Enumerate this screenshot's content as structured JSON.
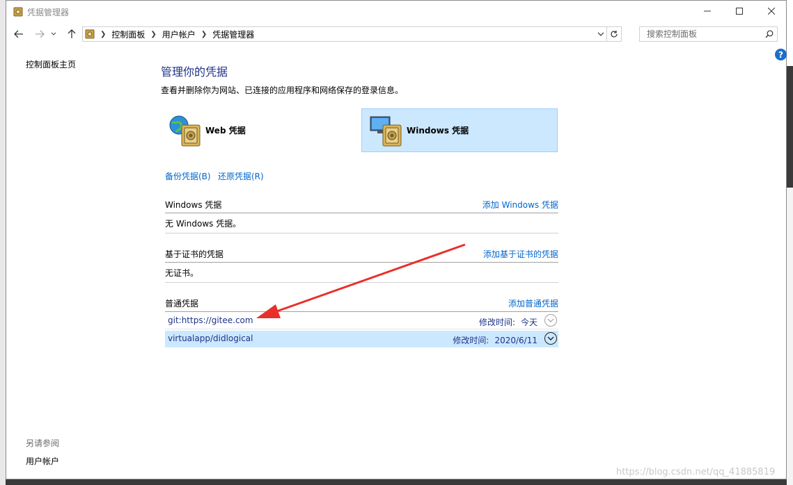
{
  "window": {
    "title": "凭据管理器"
  },
  "breadcrumb": [
    "控制面板",
    "用户帐户",
    "凭据管理器"
  ],
  "search": {
    "placeholder": "搜索控制面板"
  },
  "help": {
    "label": "?"
  },
  "sidebar": {
    "home": "控制面板主页",
    "see_also_heading": "另请参阅",
    "see_also_items": [
      "用户帐户"
    ]
  },
  "main": {
    "title": "管理你的凭据",
    "description": "查看并删除你为网站、已连接的应用程序和网络保存的登录信息。",
    "tiles": [
      {
        "label": "Web 凭据",
        "icon": "web-credential-icon",
        "selected": false
      },
      {
        "label": "Windows 凭据",
        "icon": "windows-credential-icon",
        "selected": true
      }
    ],
    "backup": "备份凭据(B)",
    "restore": "还原凭据(R)",
    "sections": {
      "windows": {
        "title": "Windows 凭据",
        "add": "添加 Windows 凭据",
        "empty": "无 Windows 凭据。"
      },
      "certificate": {
        "title": "基于证书的凭据",
        "add": "添加基于证书的凭据",
        "empty": "无证书。"
      },
      "generic": {
        "title": "普通凭据",
        "add": "添加普通凭据",
        "items": [
          {
            "name": "git:https://gitee.com",
            "modified_label": "修改时间:",
            "modified": "今天",
            "selected": false
          },
          {
            "name": "virtualapp/didlogical",
            "modified_label": "修改时间:",
            "modified": "2020/6/11",
            "selected": true
          }
        ]
      }
    }
  },
  "watermark": "https://blog.csdn.net/qq_41885819",
  "colors": {
    "accent_link": "#0066cc",
    "title": "#1e3287",
    "selection": "#cce8ff",
    "annotation_arrow": "#e8302a"
  }
}
